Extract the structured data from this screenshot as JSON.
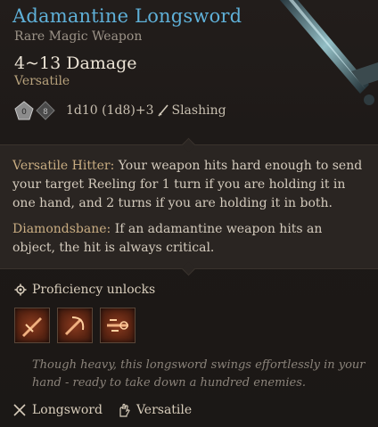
{
  "item": {
    "name": "Adamantine Longsword",
    "rarity_type": "Rare Magic Weapon",
    "damage": "4~13 Damage",
    "property": "Versatile",
    "dice": {
      "die1_label": "0",
      "die2_label": "8",
      "formula": "1d10 (1d8)+3",
      "damage_type": "Slashing"
    }
  },
  "description": {
    "versatile_label": "Versatile Hitter:",
    "versatile_text": "Your weapon hits hard enough to send your target Reeling for 1 turn if you are holding it in one hand, and 2 turns if you are holding it in both.",
    "diamonds_label": "Diamondsbane:",
    "diamonds_text": "If an adamantine weapon hits an object, the hit is always critical."
  },
  "proficiency": {
    "label": "Proficiency unlocks",
    "skills": [
      "skill-icon-1",
      "skill-icon-2",
      "skill-icon-3"
    ]
  },
  "flavor": "Though heavy, this longsword swings effortlessly in your hand - ready to take down a hundred enemies.",
  "footer": {
    "weapon_type": "Longsword",
    "trait": "Versatile"
  },
  "colors": {
    "title": "#5fb0d8",
    "label": "#c9ad82",
    "skill_bg": "#8a3a1e"
  }
}
